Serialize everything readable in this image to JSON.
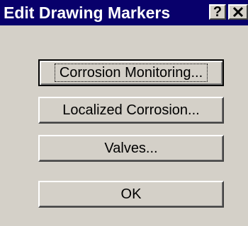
{
  "window": {
    "title": "Edit Drawing Markers",
    "help_glyph": "?",
    "close_icon": "close-icon",
    "colors": {
      "titlebar": "#08006b",
      "face": "#d4d0c8"
    }
  },
  "buttons": {
    "corrosion_monitoring": "Corrosion Monitoring...",
    "localized_corrosion": "Localized Corrosion...",
    "valves": "Valves...",
    "ok": "OK"
  }
}
